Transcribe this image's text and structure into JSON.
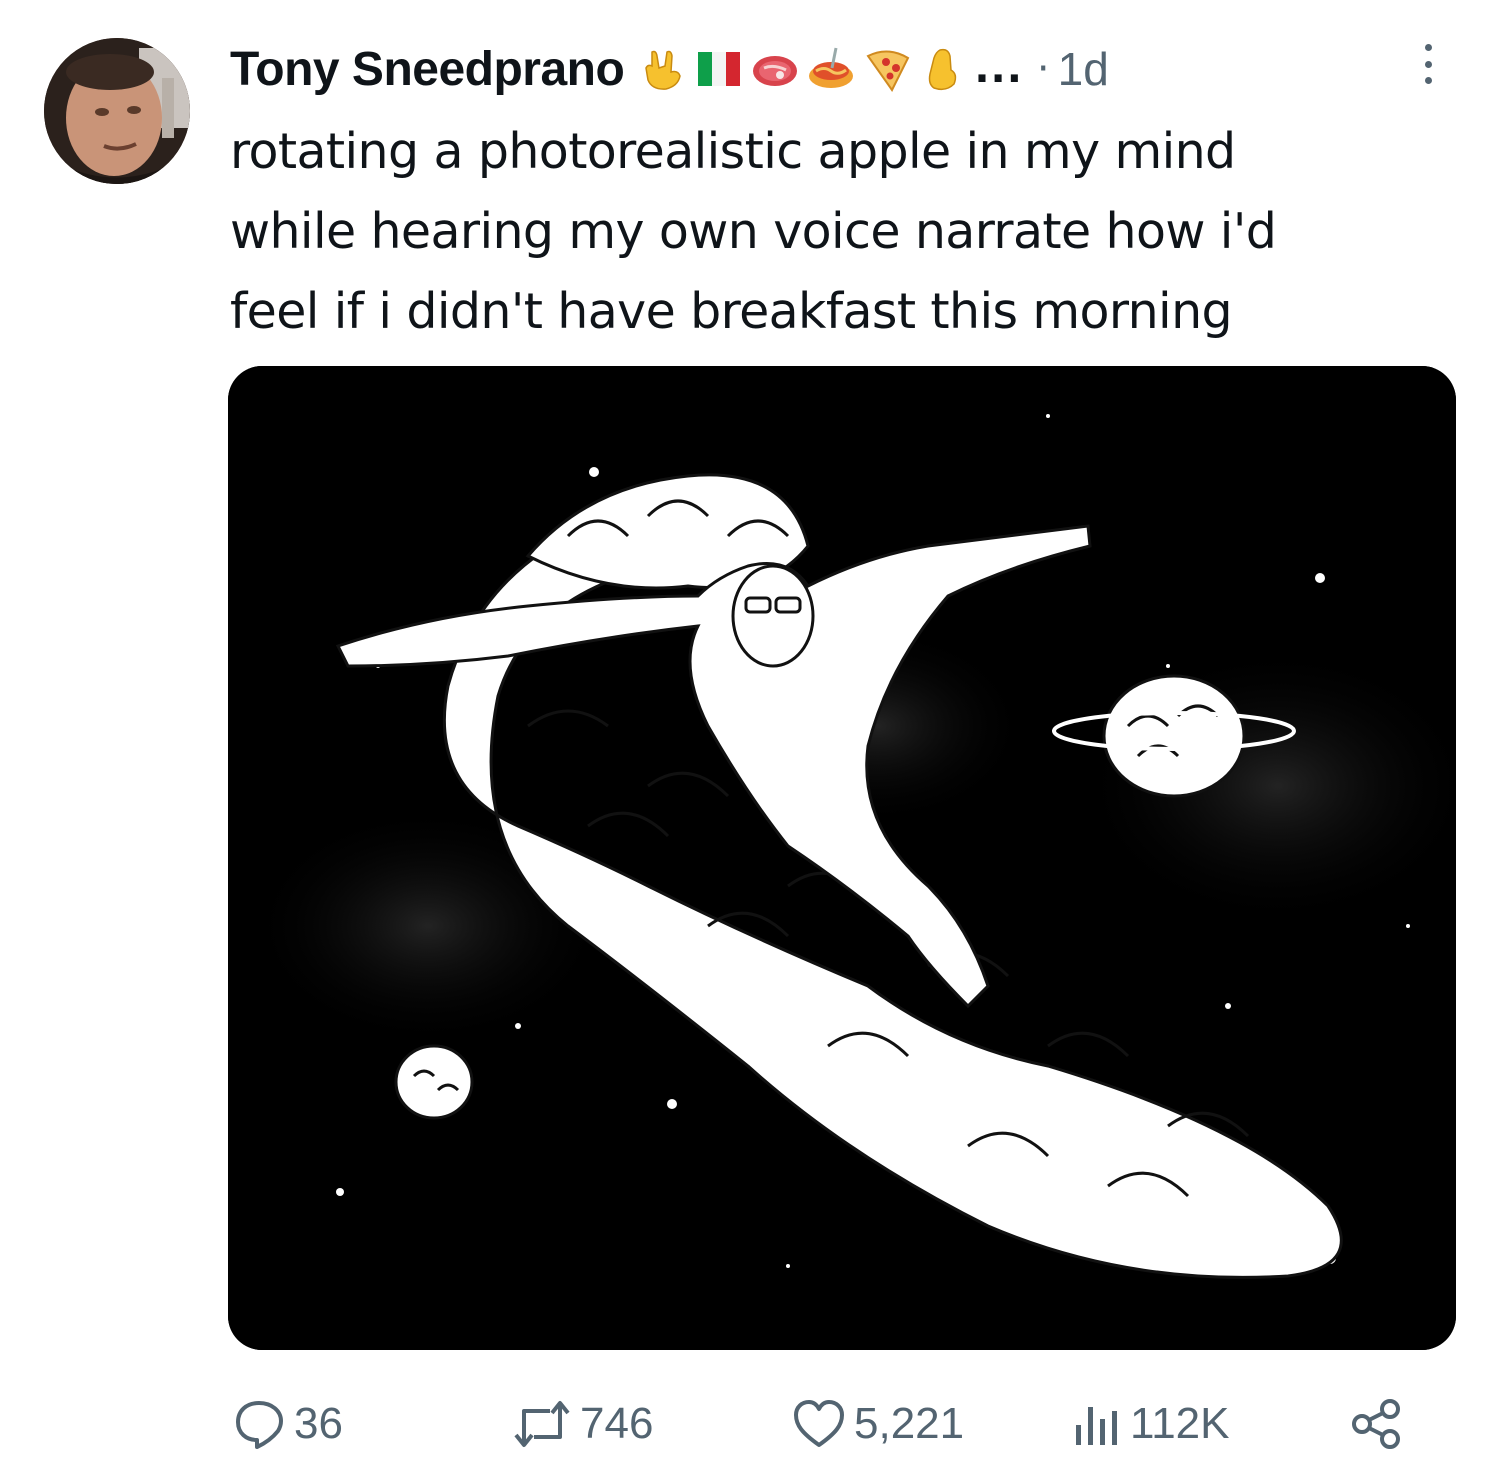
{
  "tweet": {
    "author": {
      "display_name": "Tony Sneedprano",
      "name_emojis": [
        "sign-of-horns-emoji",
        "italy-flag-emoji",
        "steak-emoji",
        "spaghetti-emoji",
        "pizza-emoji",
        "pinched-fingers-emoji"
      ],
      "truncation": "...",
      "avatar": "profile-photo"
    },
    "separator": "·",
    "timestamp": "1d",
    "text_lines": [
      "rotating a photorealistic apple in my mind",
      "while hearing my own voice narrate how i'd",
      "feel if i didn't have breakfast this morning"
    ],
    "media": {
      "kind": "image",
      "description": "wojak-brain-surfer-in-space"
    },
    "actions": {
      "replies": "36",
      "reposts": "746",
      "likes": "5,221",
      "views": "112K",
      "share_icon": "share-icon"
    }
  },
  "colors": {
    "text_primary": "#0f1419",
    "text_secondary": "#536471",
    "background": "#ffffff",
    "media_background": "#000000"
  }
}
